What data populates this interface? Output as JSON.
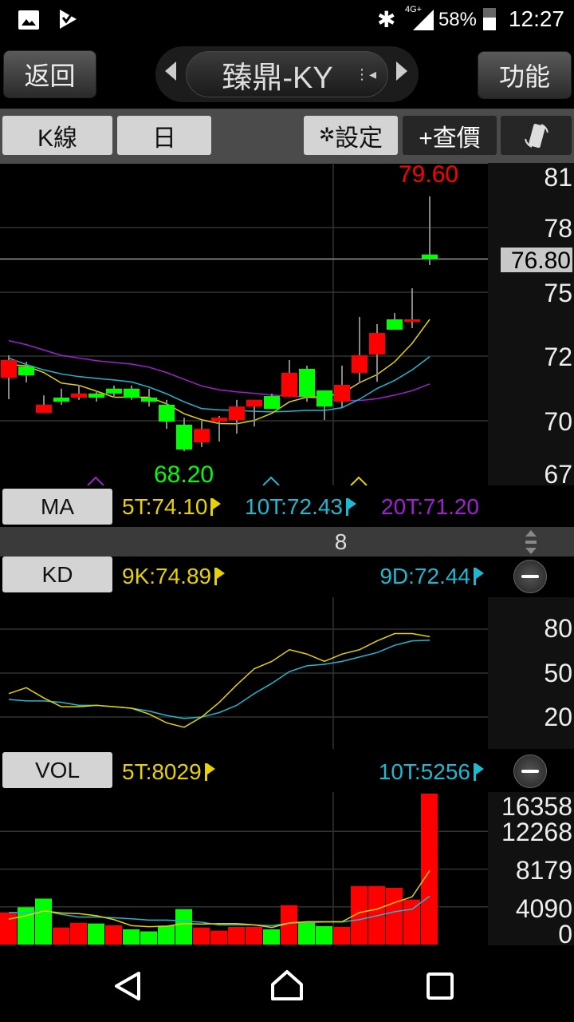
{
  "status_bar": {
    "battery": "58%",
    "time": "12:27",
    "network": "4G+",
    "icons": [
      "gallery-icon",
      "check-flag-icon",
      "bluetooth-icon",
      "signal-icon",
      "battery-icon"
    ]
  },
  "header": {
    "back_label": "返回",
    "title": "臻鼎-KY",
    "function_label": "功能"
  },
  "toolbar": {
    "chart_type": "K線",
    "period": "日",
    "settings_label": "設定",
    "quote_label": "+查價"
  },
  "price_axis": {
    "labels": [
      "81",
      "78",
      "75",
      "72",
      "70",
      "67"
    ],
    "current": "76.80"
  },
  "price_chart": {
    "high_label": "79.60",
    "low_label": "68.20"
  },
  "ma": {
    "button": "MA",
    "ma5": "5T:74.10",
    "ma10": "10T:72.43",
    "ma20": "20T:71.20"
  },
  "divider": {
    "value": "8"
  },
  "kd": {
    "button": "KD",
    "k": "9K:74.89",
    "d": "9D:72.44",
    "axis": [
      "80",
      "50",
      "20"
    ]
  },
  "vol": {
    "button": "VOL",
    "ma5": "5T:8029",
    "ma10": "10T:5256",
    "axis": [
      "16358",
      "12268",
      "8179",
      "4090",
      "0"
    ]
  },
  "colors": {
    "up": "#ff0000",
    "down": "#00ff00",
    "ma5": "#e6d200",
    "ma10": "#1fb8d0",
    "ma20": "#a020d0",
    "grid": "#333333"
  },
  "chart_data": {
    "type": "candlestick",
    "candles": [
      {
        "o": 71.49,
        "h": 72.49,
        "l": 70.53,
        "c": 72.28
      },
      {
        "o": 71.99,
        "h": 72.2,
        "l": 71.28,
        "c": 71.6
      },
      {
        "o": 69.92,
        "h": 70.7,
        "l": 69.92,
        "c": 70.28
      },
      {
        "o": 70.6,
        "h": 71.0,
        "l": 70.28,
        "c": 70.42
      },
      {
        "o": 70.6,
        "h": 71.17,
        "l": 70.5,
        "c": 70.78
      },
      {
        "o": 70.78,
        "h": 70.92,
        "l": 70.42,
        "c": 70.6
      },
      {
        "o": 71.0,
        "h": 71.14,
        "l": 70.6,
        "c": 70.78
      },
      {
        "o": 71.0,
        "h": 71.14,
        "l": 70.5,
        "c": 70.6
      },
      {
        "o": 70.6,
        "h": 71.0,
        "l": 70.2,
        "c": 70.42
      },
      {
        "o": 70.28,
        "h": 70.5,
        "l": 69.2,
        "c": 69.53
      },
      {
        "o": 69.39,
        "h": 69.7,
        "l": 68.2,
        "c": 68.28
      },
      {
        "o": 68.6,
        "h": 69.56,
        "l": 68.39,
        "c": 69.2
      },
      {
        "o": 69.53,
        "h": 69.78,
        "l": 68.64,
        "c": 69.7
      },
      {
        "o": 69.6,
        "h": 70.5,
        "l": 68.99,
        "c": 70.2
      },
      {
        "o": 70.2,
        "h": 70.5,
        "l": 69.31,
        "c": 70.5
      },
      {
        "o": 70.67,
        "h": 70.78,
        "l": 70.1,
        "c": 70.1
      },
      {
        "o": 70.64,
        "h": 72.28,
        "l": 70.64,
        "c": 71.71
      },
      {
        "o": 71.89,
        "h": 72.03,
        "l": 70.42,
        "c": 70.64
      },
      {
        "o": 70.92,
        "h": 70.92,
        "l": 69.6,
        "c": 70.2
      },
      {
        "o": 70.42,
        "h": 72.03,
        "l": 70.17,
        "c": 71.17
      },
      {
        "o": 71.71,
        "h": 74.21,
        "l": 71.24,
        "c": 72.49
      },
      {
        "o": 72.53,
        "h": 73.89,
        "l": 71.31,
        "c": 73.49
      },
      {
        "o": 74.1,
        "h": 74.39,
        "l": 73.64,
        "c": 73.64
      },
      {
        "o": 74.03,
        "h": 75.49,
        "l": 73.71,
        "c": 74.1
      },
      {
        "o": 77.0,
        "h": 79.6,
        "l": 76.53,
        "c": 76.8
      }
    ],
    "ma5": [
      72.08,
      72.02,
      71.72,
      71.25,
      71.15,
      70.89,
      70.62,
      70.62,
      70.62,
      70.32,
      69.88,
      69.61,
      69.44,
      69.43,
      69.58,
      69.9,
      70.41,
      70.62,
      70.65,
      70.79,
      71.27,
      71.63,
      72.2,
      73.03,
      74.1
    ],
    "ma10": [
      72.37,
      72.08,
      71.84,
      71.66,
      71.54,
      71.46,
      71.39,
      71.3,
      71.07,
      70.77,
      70.41,
      70.11,
      70.05,
      70.03,
      69.99,
      69.96,
      69.99,
      70.03,
      70.03,
      70.15,
      70.53,
      71.01,
      71.37,
      71.84,
      72.43
    ],
    "ma20": [
      73.15,
      72.97,
      72.73,
      72.49,
      72.37,
      72.25,
      72.17,
      72.1,
      71.96,
      71.72,
      71.42,
      71.12,
      70.95,
      70.86,
      70.79,
      70.71,
      70.67,
      70.62,
      70.53,
      70.47,
      70.47,
      70.55,
      70.71,
      70.91,
      71.21
    ],
    "price_range": [
      67,
      81
    ],
    "kd_k": [
      36,
      40,
      33,
      27,
      27,
      28,
      27,
      26,
      22,
      16,
      13,
      20,
      30,
      42,
      53,
      58,
      66,
      63,
      58,
      63,
      66,
      72,
      77,
      77,
      74.89
    ],
    "kd_d": [
      32,
      31,
      31,
      30,
      28,
      28,
      27,
      26,
      24,
      21,
      19,
      20,
      23,
      28,
      36,
      43,
      51,
      55,
      56,
      58,
      61,
      64,
      69,
      72,
      72.44
    ],
    "volume": [
      3471,
      4040,
      4979,
      1849,
      2361,
      2276,
      2077,
      1650,
      1422,
      2048,
      3841,
      1849,
      1508,
      1906,
      1906,
      1650,
      4267,
      2361,
      1991,
      1906,
      6344,
      6344,
      6145,
      4865,
      16358
    ],
    "volume_up": [
      true,
      false,
      false,
      true,
      true,
      false,
      true,
      false,
      false,
      false,
      false,
      true,
      true,
      true,
      true,
      false,
      true,
      false,
      false,
      true,
      true,
      true,
      true,
      true,
      true
    ],
    "vol_ma5": [
      2760,
      3129,
      3641,
      3414,
      3357,
      3129,
      2703,
      2048,
      1935,
      1991,
      2276,
      2219,
      2276,
      2276,
      2134,
      1849,
      2333,
      2475,
      2475,
      2475,
      3471,
      3841,
      4552,
      5178,
      8029
    ],
    "vol_ma10": [
      3471,
      3471,
      3641,
      3272,
      2987,
      2987,
      2902,
      2788,
      2646,
      2646,
      2560,
      2418,
      2134,
      2134,
      2134,
      2048,
      2333,
      2390,
      2447,
      2447,
      2703,
      3129,
      3556,
      3841,
      5256
    ],
    "volume_range": [
      0,
      16358
    ]
  }
}
